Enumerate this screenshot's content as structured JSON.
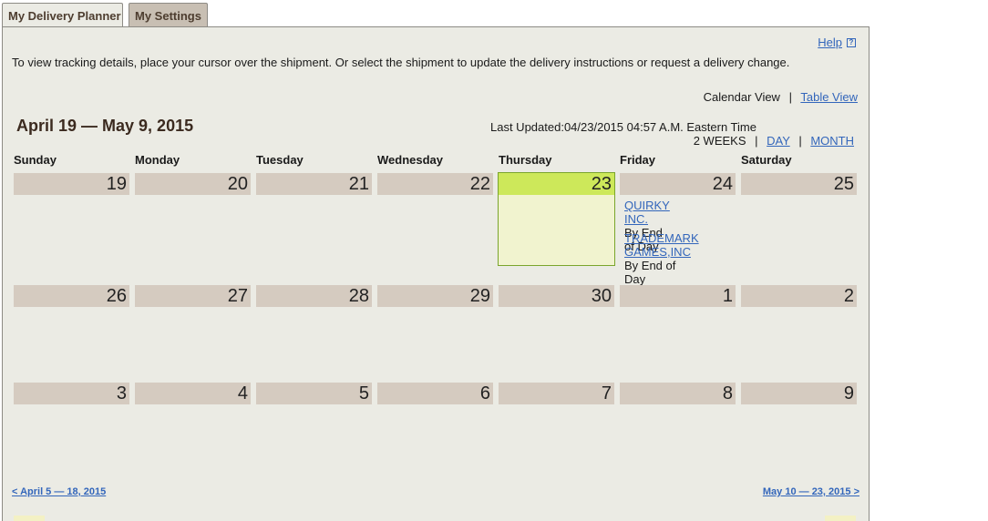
{
  "tabs": [
    {
      "label": "My Delivery Planner",
      "active": true
    },
    {
      "label": "My Settings",
      "active": false
    }
  ],
  "help": {
    "label": "Help",
    "icon": "help-question-icon",
    "icon_glyph": "?"
  },
  "instructions": "To view tracking details, place your cursor over the shipment. Or select the shipment to update the delivery instructions or request a delivery change.",
  "views": {
    "calendar": "Calendar View",
    "table": "Table View",
    "separator": "|"
  },
  "range_title": "April 19 — May 9, 2015",
  "last_updated": "Last Updated:04/23/2015 04:57 A.M. Eastern Time",
  "period": {
    "two_weeks": "2 WEEKS",
    "day": "DAY",
    "month": "MONTH",
    "separator": "|"
  },
  "day_names": [
    "Sunday",
    "Monday",
    "Tuesday",
    "Wednesday",
    "Thursday",
    "Friday",
    "Saturday"
  ],
  "weeks": [
    [
      "19",
      "20",
      "21",
      "22",
      "23",
      "24",
      "25"
    ],
    [
      "26",
      "27",
      "28",
      "29",
      "30",
      "1",
      "2"
    ],
    [
      "3",
      "4",
      "5",
      "6",
      "7",
      "8",
      "9"
    ]
  ],
  "today": {
    "week": 0,
    "day": 4
  },
  "shipments": [
    {
      "shipper": "QUIRKY INC.",
      "eta": "By End of Day"
    },
    {
      "shipper_line1": "TRADEMARK",
      "shipper_line2": "GAMES,INC",
      "eta": "By End of Day"
    }
  ],
  "nav": {
    "prev": "< April 5 — 18, 2015",
    "next": "May 10 — 23, 2015 >"
  },
  "colors": {
    "today": "#cde85a",
    "today_body": "#f1f3cf",
    "cell": "#d5cbc0",
    "panel": "#ebebe4",
    "link": "#3366bb"
  }
}
